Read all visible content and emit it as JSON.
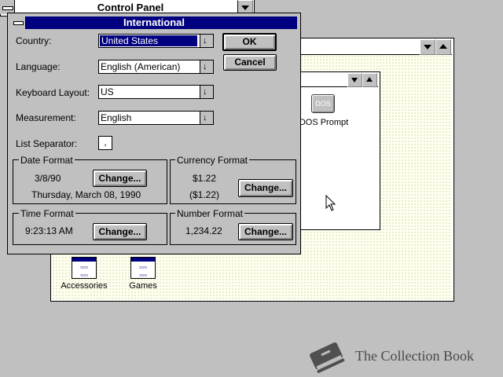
{
  "control_panel": {
    "title": "Control Panel"
  },
  "program_manager": {
    "groups": [
      {
        "label": "Accessories",
        "icon": "program-group-icon"
      },
      {
        "label": "Games",
        "icon": "program-group-icon"
      }
    ],
    "main_group": {
      "items": [
        {
          "label": "DOS Prompt",
          "icon_text": "DOS"
        }
      ]
    }
  },
  "dialog": {
    "title": "International",
    "country": {
      "label": "Country:",
      "value": "United States"
    },
    "language": {
      "label": "Language:",
      "value": "English (American)"
    },
    "keyboard": {
      "label": "Keyboard Layout:",
      "value": "US"
    },
    "measurement": {
      "label": "Measurement:",
      "value": "English"
    },
    "list_separator": {
      "label": "List Separator:",
      "value": ","
    },
    "ok_label": "OK",
    "cancel_label": "Cancel",
    "date_format": {
      "title": "Date Format",
      "short": "3/8/90",
      "long": "Thursday, March 08, 1990",
      "change_label": "Change..."
    },
    "currency_format": {
      "title": "Currency Format",
      "positive": "$1.22",
      "negative": "($1.22)",
      "change_label": "Change..."
    },
    "time_format": {
      "title": "Time Format",
      "value": "9:23:13 AM",
      "change_label": "Change..."
    },
    "number_format": {
      "title": "Number Format",
      "value": "1,234.22",
      "change_label": "Change..."
    }
  },
  "watermark": {
    "text": "The Collection Book",
    "icon": "book-icon"
  },
  "colors": {
    "title_active": "#000080",
    "face": "#c0c0c0",
    "desktop": "#c0c0c0"
  }
}
